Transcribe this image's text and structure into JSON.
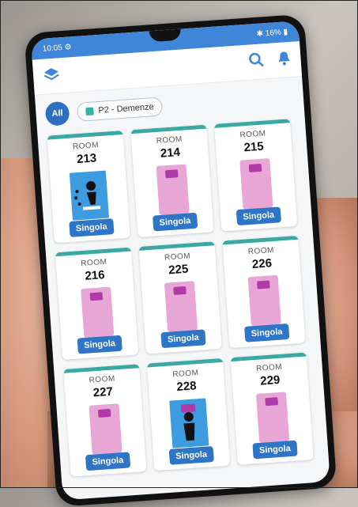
{
  "status_bar": {
    "time": "10:05",
    "battery": "16%"
  },
  "filters": {
    "all_label": "All",
    "ward_label": "P2 - Demenze"
  },
  "room_label": "ROOM",
  "rooms": [
    {
      "number": "213",
      "type": "Singola",
      "occupancy": "wandering"
    },
    {
      "number": "214",
      "type": "Singola",
      "occupancy": "empty"
    },
    {
      "number": "215",
      "type": "Singola",
      "occupancy": "empty"
    },
    {
      "number": "216",
      "type": "Singola",
      "occupancy": "empty"
    },
    {
      "number": "225",
      "type": "Singola",
      "occupancy": "empty"
    },
    {
      "number": "226",
      "type": "Singola",
      "occupancy": "empty"
    },
    {
      "number": "227",
      "type": "Singola",
      "occupancy": "empty"
    },
    {
      "number": "228",
      "type": "Singola",
      "occupancy": "in-bed"
    },
    {
      "number": "229",
      "type": "Singola",
      "occupancy": "empty"
    }
  ],
  "colors": {
    "header": "#3f86d8",
    "card_accent": "#3aa9a4",
    "bed": "#e8a6d6",
    "badge": "#2f75c7"
  }
}
